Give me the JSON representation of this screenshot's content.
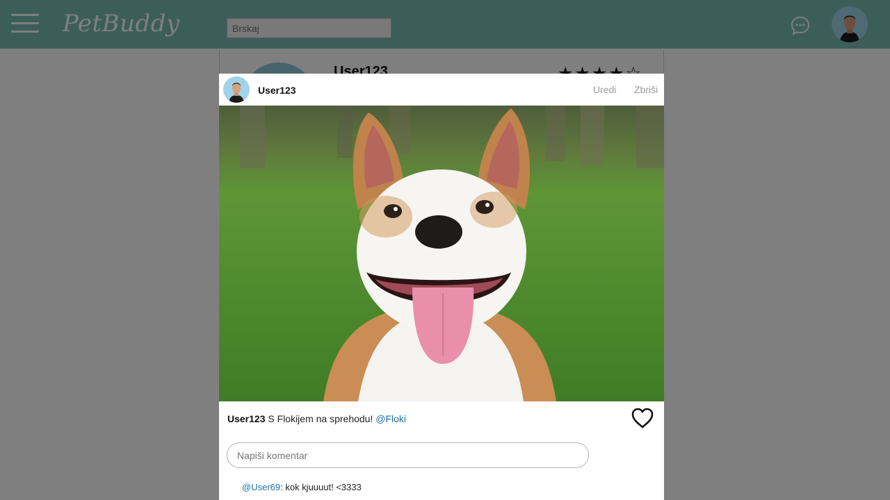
{
  "app": {
    "brand": "PetBuddy"
  },
  "header": {
    "search_placeholder": "Brskaj"
  },
  "profile": {
    "name": "User123",
    "rating": "★★★★☆"
  },
  "post": {
    "user": "User123",
    "actions": {
      "edit": "Uredi",
      "delete": "Zbriši"
    },
    "caption_user": "User123",
    "caption_text": "S Flokijem na sprehodu!",
    "caption_tag": "@Floki",
    "comment_placeholder": "Napiši komentar",
    "comments": [
      {
        "user": "@User69",
        "text": ": kok kjuuuut! <3333"
      }
    ]
  },
  "colors": {
    "topbar": "#78bdb2",
    "link": "#1b6fa8",
    "muted": "#9a9a9a"
  }
}
